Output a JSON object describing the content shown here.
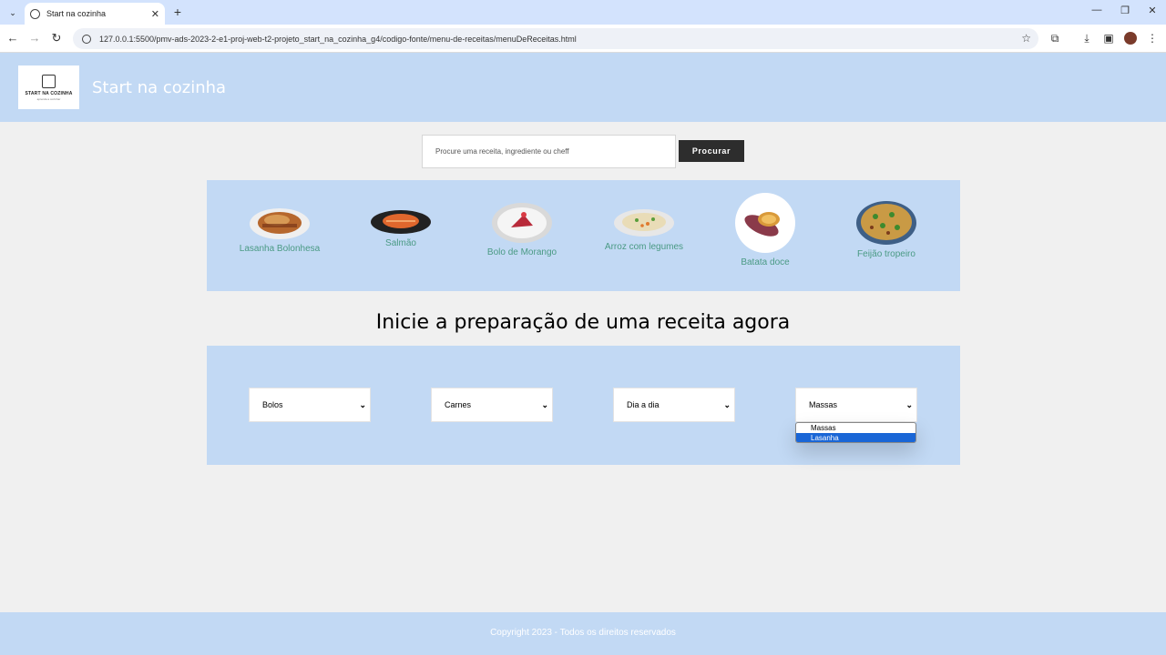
{
  "browser": {
    "tab_title": "Start na cozinha",
    "url": "127.0.0.1:5500/pmv-ads-2023-2-e1-proj-web-t2-projeto_start_na_cozinha_g4/codigo-fonte/menu-de-receitas/menuDeReceitas.html"
  },
  "header": {
    "logo_text": "START NA COZINHA",
    "logo_sub": "aprenda a cozinhar",
    "brand": "Start na cozinha"
  },
  "search": {
    "placeholder": "Procure uma receita, ingrediente ou cheff",
    "button_label": "Procurar"
  },
  "recipes": [
    {
      "label": "Lasanha Bolonhesa"
    },
    {
      "label": "Salmão"
    },
    {
      "label": "Bolo de Morango"
    },
    {
      "label": "Arroz com legumes"
    },
    {
      "label": "Batata doce"
    },
    {
      "label": "Feijão tropeiro"
    }
  ],
  "headline": "Inicie a preparação de uma receita agora",
  "selects": [
    {
      "value": "Bolos"
    },
    {
      "value": "Carnes"
    },
    {
      "value": "Dia a dia"
    },
    {
      "value": "Massas"
    }
  ],
  "dropdown_options": [
    "Massas",
    "Lasanha"
  ],
  "footer": "Copyright 2023 - Todos os direitos reservados",
  "colors": {
    "panel": "#c2d9f4",
    "recipe_label": "#4a9a84",
    "button": "#2d2d2d",
    "option_highlight": "#1a66d6"
  }
}
